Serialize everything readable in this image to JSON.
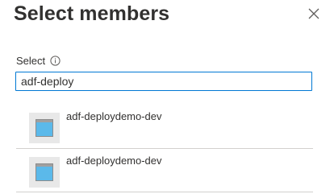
{
  "panel": {
    "title": "Select members"
  },
  "search": {
    "label": "Select",
    "value": "adf-deploy"
  },
  "results": [
    {
      "name": "adf-deploydemo-dev",
      "icon": "app-registration-icon"
    },
    {
      "name": "adf-deploydemo-dev",
      "icon": "app-registration-icon"
    }
  ],
  "colors": {
    "accent": "#0078d4",
    "text": "#323130",
    "divider": "#d2d0ce"
  }
}
